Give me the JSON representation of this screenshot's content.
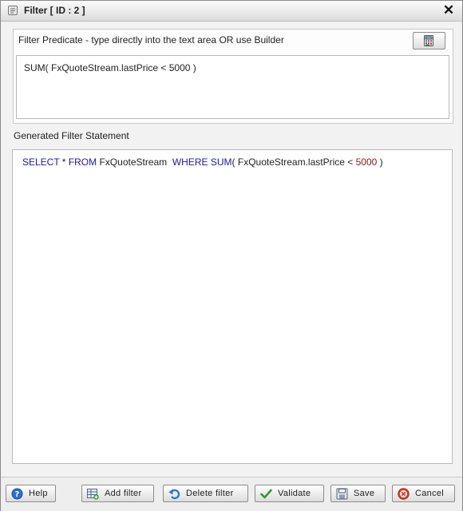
{
  "window": {
    "title": "Filter [ ID : 2 ]",
    "title_icon": "filter-dialog-icon",
    "close_label": "✕"
  },
  "predicate": {
    "label": "Filter Predicate - type directly into the text area OR use Builder",
    "builder_icon": "calculator-icon",
    "value": "SUM( FxQuoteStream.lastPrice < 5000 )"
  },
  "generated": {
    "label": "Generated Filter Statement",
    "tokens": {
      "select": "SELECT",
      "star": " * ",
      "from": "FROM",
      "stream": " FxQuoteStream  ",
      "where": "WHERE",
      "space": " ",
      "sum": "SUM",
      "open": "( ",
      "field": "FxQuoteStream.lastPrice",
      "lt": " < ",
      "number": "5000",
      "close": " )"
    }
  },
  "footer": {
    "help": "Help",
    "add_filter": "Add filter",
    "delete_filter": "Delete filter",
    "validate": "Validate",
    "save": "Save",
    "cancel": "Cancel"
  },
  "colors": {
    "keyword": "#1a1aa6",
    "number": "#8b1a1a",
    "help_icon": "#2a6fd0",
    "validate_icon": "#2e9a2e",
    "cancel_icon": "#d9432b"
  }
}
